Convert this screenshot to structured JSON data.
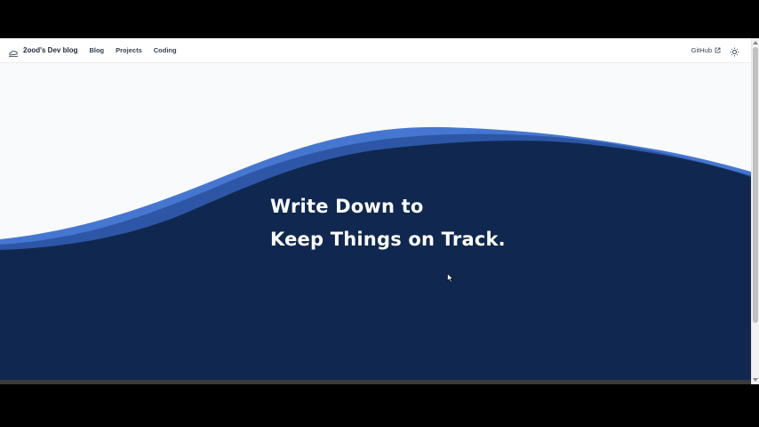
{
  "header": {
    "brand_name": "2ood's Dev blog",
    "brand_icon": "cloud-logo-icon",
    "nav": [
      {
        "label": "Blog"
      },
      {
        "label": "Projects"
      },
      {
        "label": "Coding"
      }
    ],
    "github_label": "GitHub",
    "external_icon": "external-link-icon",
    "theme_icon": "sun-icon"
  },
  "hero": {
    "line1": "Write Down to",
    "line2": "Keep Things on Track."
  },
  "colors": {
    "wave_light": "#4577d1",
    "wave_mid": "#2d56a6",
    "wave_dark": "#10284f",
    "page_bg": "#f9fafb"
  }
}
